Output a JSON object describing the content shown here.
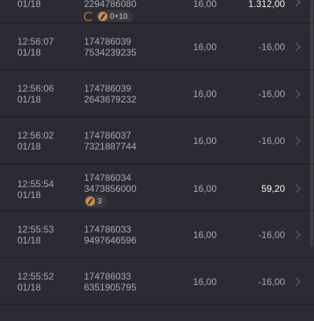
{
  "rows": [
    {
      "time": "",
      "date": "01/18",
      "id1": "",
      "id2": "2294786080",
      "bet": "16,00",
      "result": "1.312,00",
      "positive": true,
      "badges": {
        "refresh": true,
        "count": "0+10"
      }
    },
    {
      "time": "12:56:07",
      "date": "01/18",
      "id1": "174786039",
      "id2": "7534239235",
      "bet": "16,00",
      "result": "-16,00",
      "positive": false
    },
    {
      "time": "12:56:06",
      "date": "01/18",
      "id1": "174786039",
      "id2": "2643679232",
      "bet": "16,00",
      "result": "-16,00",
      "positive": false
    },
    {
      "time": "12:56:02",
      "date": "01/18",
      "id1": "174786037",
      "id2": "7321887744",
      "bet": "16,00",
      "result": "-16,00",
      "positive": false
    },
    {
      "time": "12:55:54",
      "date": "01/18",
      "id1": "174786034",
      "id2": "3473856000",
      "bet": "16,00",
      "result": "59,20",
      "positive": true,
      "badges": {
        "refresh": false,
        "count": "3"
      }
    },
    {
      "time": "12:55:53",
      "date": "01/18",
      "id1": "174786033",
      "id2": "9497646596",
      "bet": "16,00",
      "result": "-16,00",
      "positive": false
    },
    {
      "time": "12:55:52",
      "date": "01/18",
      "id1": "174786033",
      "id2": "6351905795",
      "bet": "16,00",
      "result": "-16,00",
      "positive": false
    }
  ],
  "colors": {
    "background": "#27262d",
    "row": "#2c2b33",
    "text_muted": "#a9a8b0",
    "text_positive": "#f4f4f6",
    "badge_accent": "#c78a4b"
  },
  "icons": {
    "refresh": "refresh-icon",
    "bolt": "bonus-icon",
    "chevron": "chevron-right-icon"
  }
}
